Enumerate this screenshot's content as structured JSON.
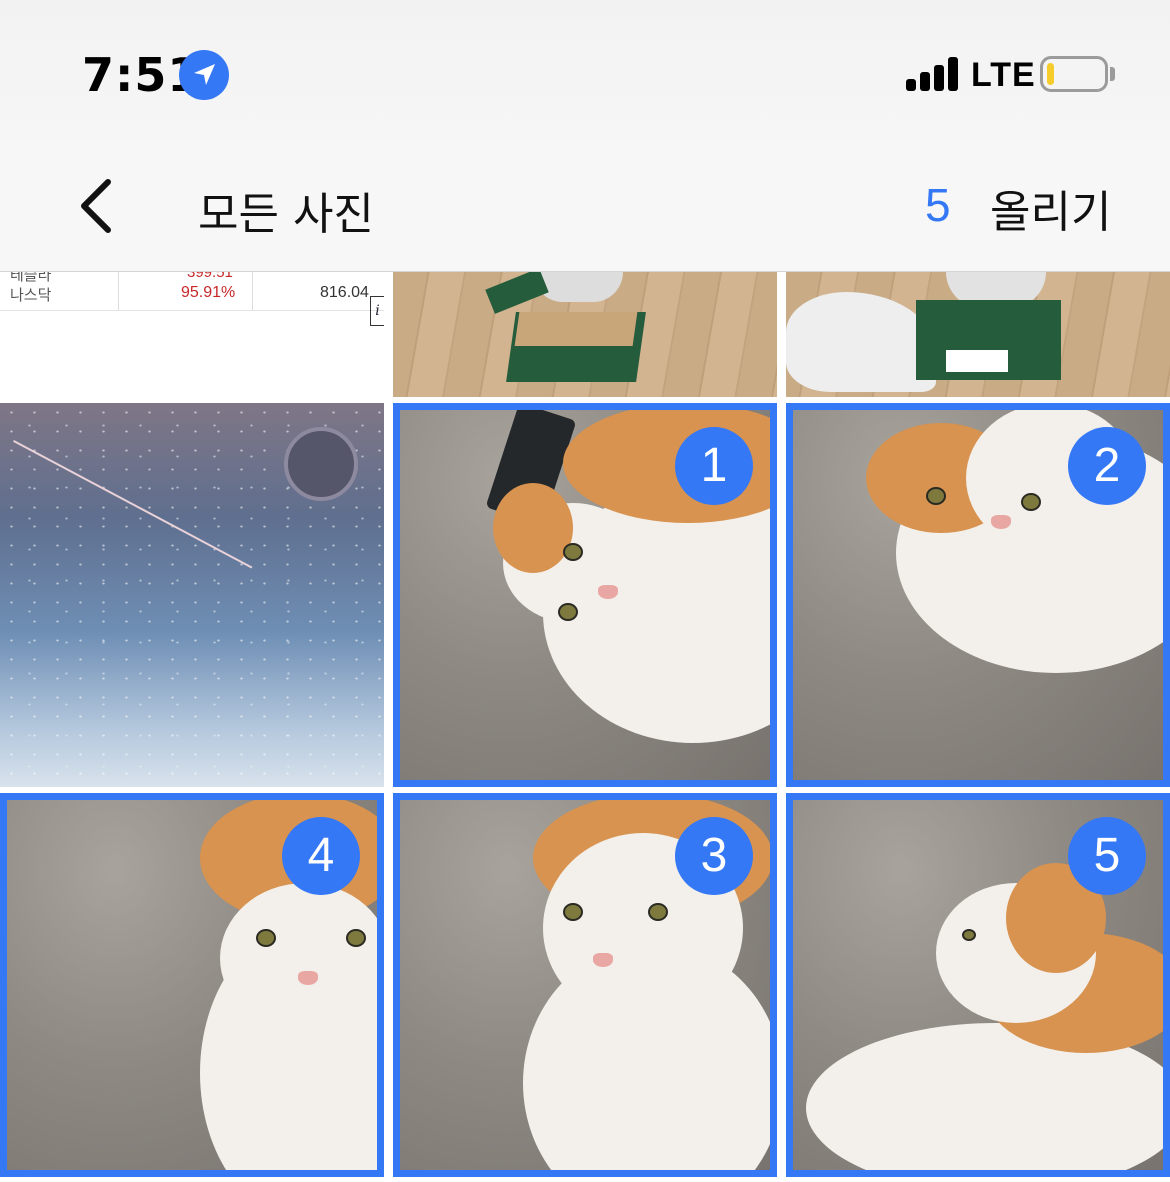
{
  "status_bar": {
    "time": "7:51",
    "network": "LTE",
    "icons": [
      "location-arrow-icon",
      "cellular-signal-icon",
      "battery-low-icon"
    ],
    "battery_level": 0.12,
    "colors": {
      "location": "#3478f6",
      "battery_fill": "#f5cc2a"
    }
  },
  "nav": {
    "back_icon": "chevron-left-icon",
    "title": "모든 사진",
    "selected_count": "5",
    "upload_label": "올리기",
    "accent_color": "#3478f6"
  },
  "grid": {
    "partial_row": [
      {
        "kind": "stock-screenshot",
        "row1": {
          "name": "테슬라",
          "value": "399.51"
        },
        "row2": {
          "name": "나스닥",
          "pct": "95.91%",
          "value": "816.04"
        },
        "info_icon": "i"
      },
      {
        "kind": "photo",
        "subject": "cat in green box"
      },
      {
        "kind": "photo",
        "subject": "cat in green box with paper"
      }
    ],
    "photos": [
      {
        "subject": "night sky with streak",
        "selected": false,
        "order": ""
      },
      {
        "subject": "cat lying on sofa",
        "selected": true,
        "order": "1"
      },
      {
        "subject": "cat on sofa looking",
        "selected": true,
        "order": "2"
      },
      {
        "subject": "cat portrait",
        "selected": true,
        "order": "4"
      },
      {
        "subject": "cat close-up",
        "selected": true,
        "order": "3"
      },
      {
        "subject": "cat profile",
        "selected": true,
        "order": "5"
      }
    ]
  }
}
